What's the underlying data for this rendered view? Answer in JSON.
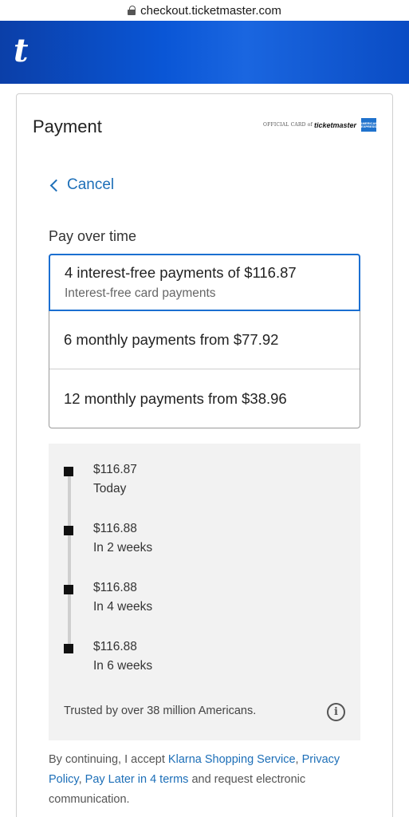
{
  "browser": {
    "url": "checkout.ticketmaster.com"
  },
  "brand": {
    "logo_text": "t",
    "color": "#0a56d6"
  },
  "card": {
    "title": "Payment",
    "amex": {
      "prefix": "OFFICIAL CARD of",
      "brand": "ticketmaster",
      "logo": "AMERICAN EXPRESS",
      "color": "#1f72cd"
    },
    "cancel_label": "Cancel",
    "section_title": "Pay over time",
    "options": [
      {
        "title": "4 interest-free payments of $116.87",
        "subtitle": "Interest-free card payments",
        "selected": true
      },
      {
        "title": "6 monthly payments from $77.92",
        "selected": false
      },
      {
        "title": "12 monthly payments from $38.96",
        "selected": false
      }
    ],
    "schedule": [
      {
        "amount": "$116.87",
        "when": "Today"
      },
      {
        "amount": "$116.88",
        "when": "In 2 weeks"
      },
      {
        "amount": "$116.88",
        "when": "In 4 weeks"
      },
      {
        "amount": "$116.88",
        "when": "In 6 weeks"
      }
    ],
    "trusted_text": "Trusted by over 38 million Americans.",
    "info_icon": "i",
    "legal": {
      "prefix": "By continuing, I accept ",
      "link1": "Klarna Shopping Service",
      "sep": ", ",
      "link2": "Privacy Policy",
      "sep2": ", ",
      "link3": "Pay Later in 4 terms",
      "suffix": " and request electronic communication."
    },
    "accent_color": "#1b6fd1"
  }
}
